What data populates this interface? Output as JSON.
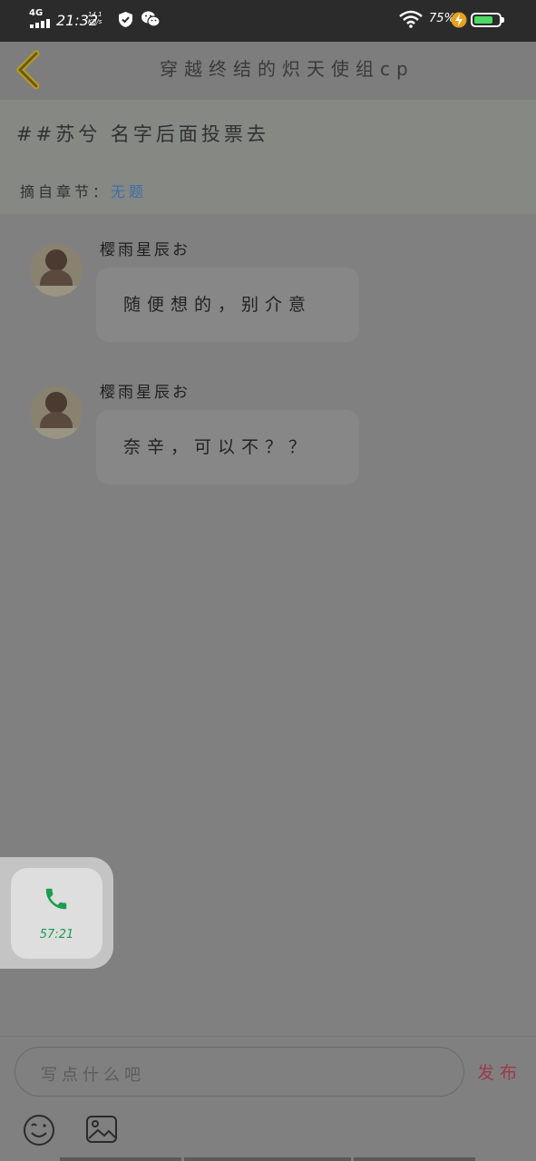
{
  "status_bar": {
    "network": "4G",
    "time": "21:32",
    "speed_value": "14.1",
    "speed_unit": "KB/s",
    "battery_percent": "75%",
    "battery_level": 0.75,
    "icons": [
      "signal-icon",
      "shield-icon",
      "wechat-icon",
      "wifi-icon",
      "charging-icon",
      "battery-icon"
    ]
  },
  "header": {
    "back_icon": "chevron-left-icon",
    "title": "穿越终结的炽天使组cp"
  },
  "topic": {
    "text": "##苏兮 名字后面投票去",
    "source_label": "摘自章节：",
    "source_link": "无题"
  },
  "messages": [
    {
      "author": "樱雨星辰お",
      "text": "随便想的，别介意"
    },
    {
      "author": "樱雨星辰お",
      "text": "奈辛，可以不？？"
    }
  ],
  "call_widget": {
    "icon": "phone-icon",
    "timer": "57:21",
    "accent_color": "#1a9c51"
  },
  "composer": {
    "placeholder": "写点什么吧",
    "publish_label": "发布",
    "emoji_icon": "emoji-icon",
    "image_icon": "image-icon"
  }
}
